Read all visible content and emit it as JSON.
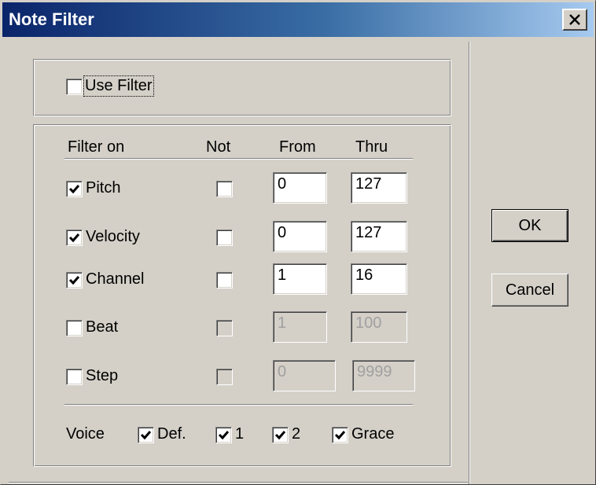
{
  "window": {
    "title": "Note Filter"
  },
  "use_filter": {
    "label": "Use Filter",
    "checked": false
  },
  "columns": {
    "filter_on": "Filter on",
    "not": "Not",
    "from": "From",
    "thru": "Thru"
  },
  "rows": [
    {
      "label": "Pitch",
      "checked": true,
      "not_checked": false,
      "from": "0",
      "thru": "127",
      "enabled": true
    },
    {
      "label": "Velocity",
      "checked": true,
      "not_checked": false,
      "from": "0",
      "thru": "127",
      "enabled": true
    },
    {
      "label": "Channel",
      "checked": true,
      "not_checked": false,
      "from": "1",
      "thru": "16",
      "enabled": true
    },
    {
      "label": "Beat",
      "checked": false,
      "not_checked": false,
      "from": "1",
      "thru": "100",
      "enabled": false
    },
    {
      "label": "Step",
      "checked": false,
      "not_checked": false,
      "from": "0",
      "thru": "9999",
      "enabled": false
    }
  ],
  "voice": {
    "label": "Voice",
    "options": [
      {
        "label": "Def.",
        "checked": true
      },
      {
        "label": "1",
        "checked": true
      },
      {
        "label": "2",
        "checked": true
      },
      {
        "label": "Grace",
        "checked": true
      }
    ]
  },
  "buttons": {
    "ok": "OK",
    "cancel": "Cancel"
  }
}
